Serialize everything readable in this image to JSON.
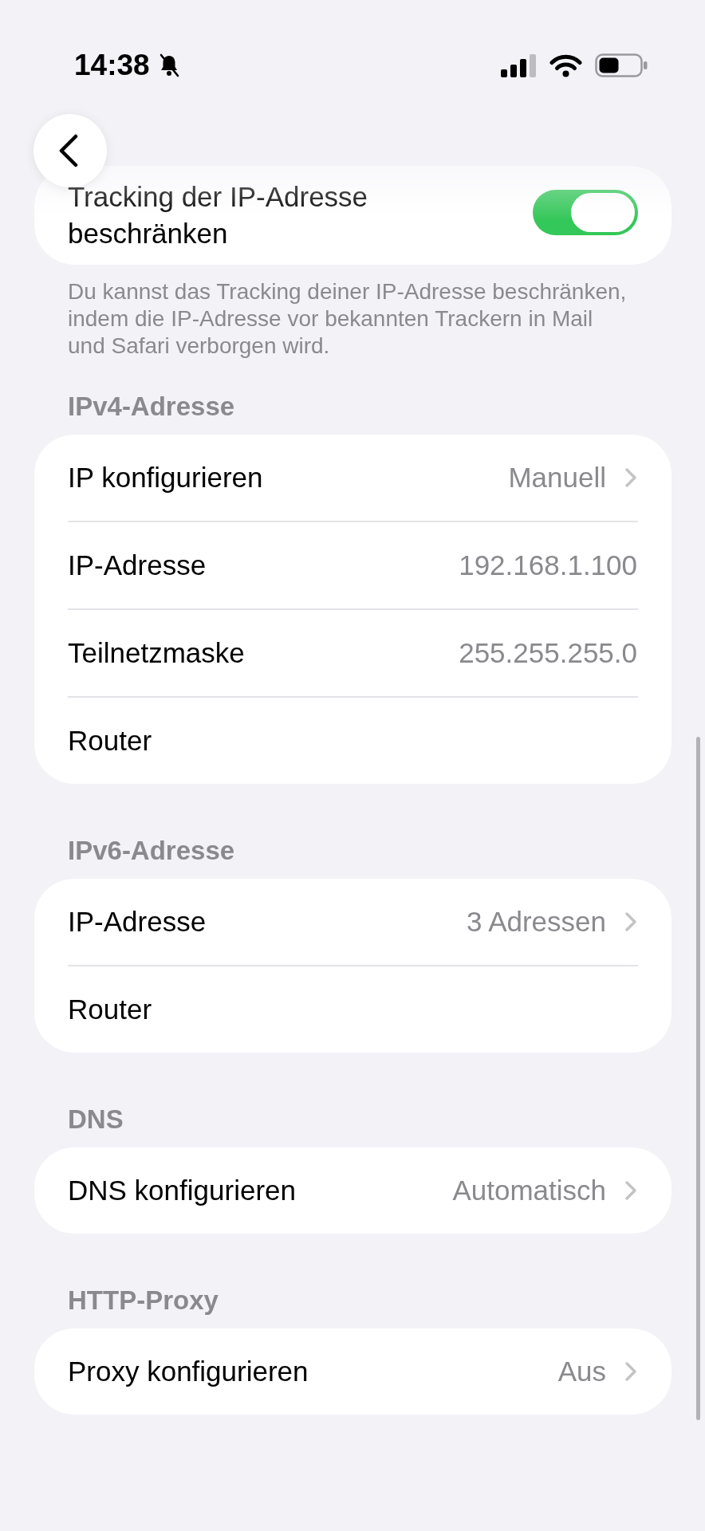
{
  "status_bar": {
    "time": "14:38"
  },
  "privacy_toggle": {
    "label": "Tracking der IP-Adresse beschränken",
    "on": true,
    "footer": "Du kannst das Tracking deiner IP-Adresse beschränken, indem die IP-Adresse vor bekannten Trackern in Mail und Safari verborgen wird."
  },
  "sections": [
    {
      "header": "IPv4-Adresse",
      "rows": [
        {
          "kind": "navigation",
          "label": "IP konfigurieren",
          "value": "Manuell"
        },
        {
          "kind": "info",
          "label": "IP-Adresse",
          "value": "192.168.1.100"
        },
        {
          "kind": "info",
          "label": "Teilnetzmaske",
          "value": "255.255.255.0"
        },
        {
          "kind": "info",
          "label": "Router"
        }
      ]
    },
    {
      "header": "IPv6-Adresse",
      "rows": [
        {
          "kind": "navigation",
          "label": "IP-Adresse",
          "value": "3 Adressen"
        },
        {
          "kind": "info",
          "label": "Router"
        }
      ]
    },
    {
      "header": "DNS",
      "rows": [
        {
          "kind": "navigation",
          "label": "DNS konfigurieren",
          "value": "Automatisch"
        }
      ]
    },
    {
      "header": "HTTP-Proxy",
      "rows": [
        {
          "kind": "navigation",
          "label": "Proxy konfigurieren",
          "value": "Aus"
        }
      ]
    }
  ]
}
